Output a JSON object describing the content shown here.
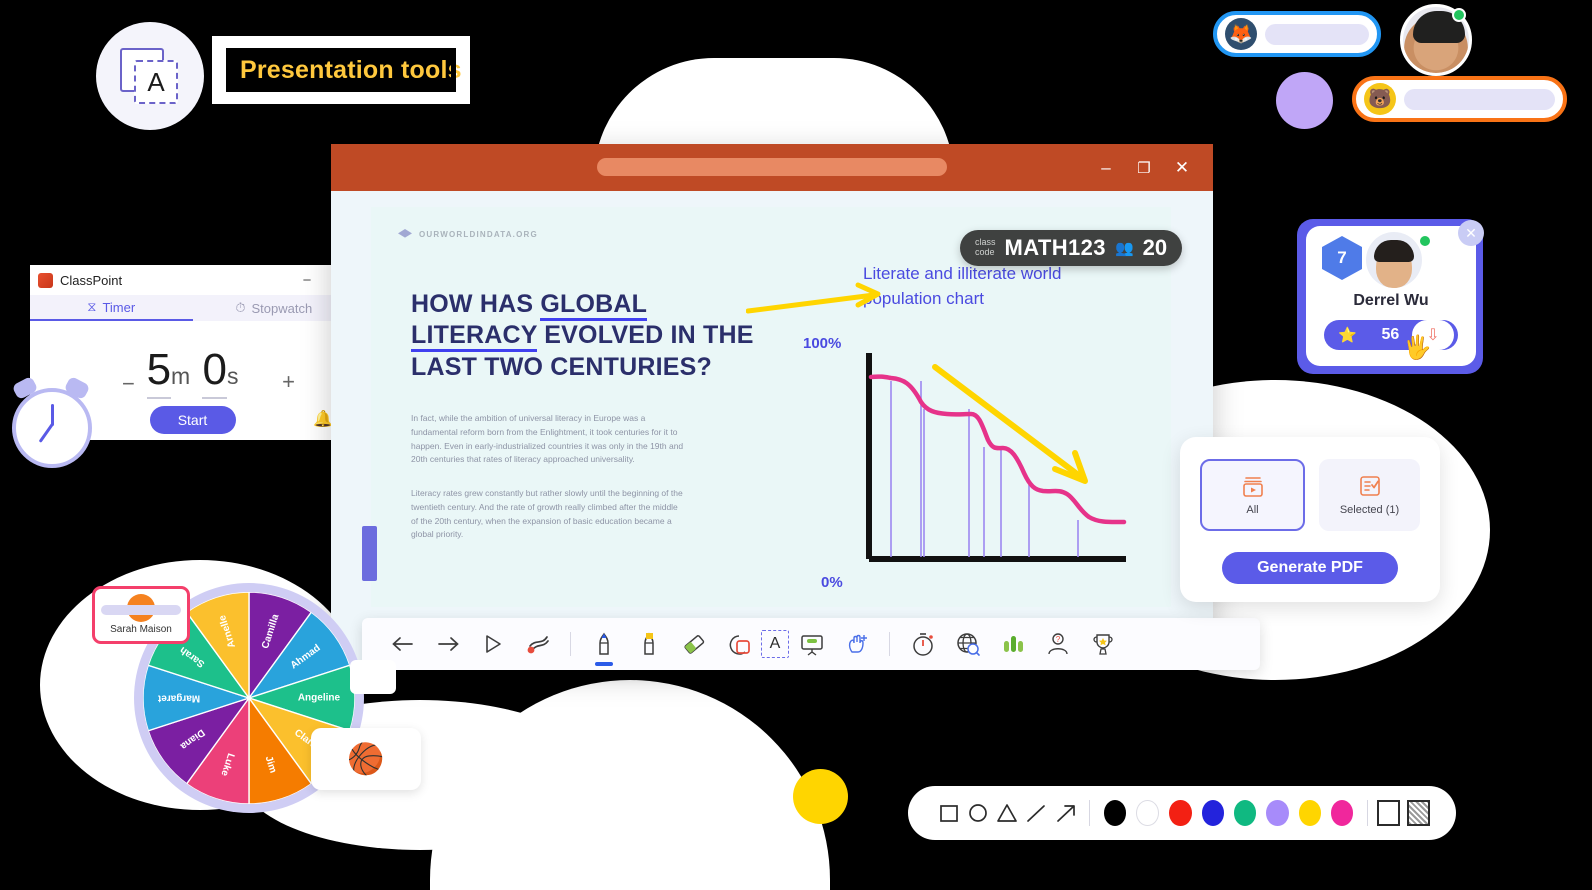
{
  "presentation_tools": {
    "label": "Presentation tools",
    "icon_letter": "A",
    "icon_name": "text-box-icon"
  },
  "top_pills": [
    {
      "avatar_icon": "fox-avatar",
      "emoji": "🦊",
      "color": "#2196F3"
    },
    {
      "avatar_icon": "bear-avatar",
      "emoji": "🐻",
      "color": "#F97316"
    }
  ],
  "classpoint_timer": {
    "title": "ClassPoint",
    "tabs": [
      {
        "label": "Timer",
        "icon": "hourglass-icon",
        "glyph": "⧖",
        "active": true
      },
      {
        "label": "Stopwatch",
        "icon": "stopwatch-icon",
        "glyph": "⏱",
        "active": false
      }
    ],
    "minutes": "5",
    "minutes_unit": "m",
    "seconds": "0",
    "seconds_unit": "s",
    "decrease_label": "−",
    "increase_label": "+",
    "start_label": "Start",
    "bell_icon": "bell-icon",
    "minimize_label": "−",
    "close_label": "✕"
  },
  "presentation_window": {
    "minimize_label": "–",
    "maximize_label": "❐",
    "close_label": "✕",
    "slide": {
      "source_label": "OURWORLDINDATA.ORG",
      "heading_parts": [
        {
          "text": "HOW HAS ",
          "underline": false
        },
        {
          "text": "GLOBAL LITERACY",
          "underline": true
        },
        {
          "text": " EVOLVED IN THE LAST TWO CENTURIES?",
          "underline": false
        }
      ],
      "heading_plain": "HOW HAS GLOBAL LITERACY EVOLVED IN THE LAST TWO CENTURIES?",
      "paragraph_1": "In fact, while the ambition of universal literacy in Europe was a fundamental reform born from the Enlightment, it took centuries for it to happen. Even in early-industrialized countries it was only in the 19th and 20th centuries that rates of literacy approached universality.",
      "paragraph_2": "Literacy rates grew constantly but rather slowly until the beginning of the twentieth century. And the rate of growth really climbed after the middle of the 20th century, when the expansion of basic education became a global priority."
    },
    "class_code": {
      "label_line1": "class",
      "label_line2": "code",
      "code": "MATH123",
      "participants_icon": "people-icon",
      "participants": "20"
    }
  },
  "chart_data": {
    "type": "line",
    "title": "Literate and illiterate world population chart",
    "xlabel": "",
    "ylabel": "",
    "ylim": [
      0,
      100
    ],
    "ytick_labels": [
      "100%",
      "0%"
    ],
    "line_color": "#E6338A",
    "gridline_color": "#9D87F0",
    "grid": true,
    "legend": "none",
    "annotation_arrow_color": "#FFD500",
    "x": [
      0,
      5,
      10,
      15,
      20,
      25,
      30,
      35,
      40,
      45,
      50,
      55,
      60,
      65,
      70,
      75,
      80,
      85,
      90,
      95,
      100
    ],
    "values": [
      93,
      93,
      92,
      90,
      84,
      79,
      78,
      78,
      77,
      68,
      66,
      66,
      60,
      50,
      44,
      43,
      40,
      33,
      25,
      23,
      23
    ],
    "vertical_marker_x": [
      8,
      20,
      45,
      53,
      60,
      74,
      93
    ]
  },
  "toolbar": {
    "items": [
      {
        "name": "previous-slide-button",
        "glyph": "←",
        "label": "Previous"
      },
      {
        "name": "next-slide-button",
        "glyph": "→",
        "label": "Next"
      },
      {
        "name": "pointer-tool-button",
        "glyph": "▷",
        "label": "Pointer"
      },
      {
        "name": "laser-pointer-button",
        "glyph": "⤳",
        "label": "Laser pointer"
      },
      {
        "name": "pen-tool-button",
        "glyph": "✒",
        "label": "Pen"
      },
      {
        "name": "highlighter-tool-button",
        "glyph": "✎",
        "label": "Highlighter"
      },
      {
        "name": "eraser-tool-button",
        "glyph": "▱",
        "label": "Eraser"
      },
      {
        "name": "shapes-tool-button",
        "glyph": "⬟",
        "label": "Shapes"
      },
      {
        "name": "text-box-button",
        "glyph": "A",
        "label": "Text box"
      },
      {
        "name": "whiteboard-button",
        "glyph": "⬜",
        "label": "Whiteboard"
      },
      {
        "name": "drag-tool-button",
        "glyph": "✋",
        "label": "Drag"
      },
      {
        "name": "timer-button",
        "glyph": "⏱",
        "label": "Timer"
      },
      {
        "name": "browser-button",
        "glyph": "ἱ0",
        "label": "Embedded browser"
      },
      {
        "name": "bar-chart-button",
        "glyph": "█",
        "label": "Polls"
      },
      {
        "name": "pick-name-button",
        "glyph": "☹",
        "label": "Pick name"
      },
      {
        "name": "leaderboard-button",
        "glyph": "Ἴ6",
        "label": "Leaderboard"
      }
    ]
  },
  "student_card": {
    "level": "7",
    "name": "Derrel Wu",
    "star_icon": "star-icon",
    "points": "56",
    "deduct_icon": "down-arrow-icon",
    "close_label": "✕",
    "online": true
  },
  "pdf_panel": {
    "options": [
      {
        "label": "All",
        "icon": "slides-stack-icon",
        "selected": true
      },
      {
        "label": "Selected (1)",
        "icon": "checklist-icon",
        "selected": false
      }
    ],
    "generate_label": "Generate PDF"
  },
  "name_picker": {
    "selected_name": "Sarah Maison",
    "segments": [
      {
        "name": "Camilla",
        "color": "#7B1FA2"
      },
      {
        "name": "Ahmad",
        "color": "#29A3DC"
      },
      {
        "name": "Angeline",
        "color": "#1DC08B"
      },
      {
        "name": "Clara",
        "color": "#FBC02D"
      },
      {
        "name": "Jim",
        "color": "#F57C00"
      },
      {
        "name": "Luke",
        "color": "#EC4079"
      },
      {
        "name": "Diana",
        "color": "#7B1FA2"
      },
      {
        "name": "Margaret",
        "color": "#29A3DC"
      },
      {
        "name": "Sarah",
        "color": "#1DC08B"
      },
      {
        "name": "Arnelle",
        "color": "#FBC02D"
      }
    ],
    "reward_emoji": "🏀"
  },
  "shape_toolbar": {
    "shapes": [
      {
        "name": "rectangle-shape-button",
        "glyph": "□"
      },
      {
        "name": "ellipse-shape-button",
        "glyph": "○"
      },
      {
        "name": "triangle-shape-button",
        "glyph": "△"
      },
      {
        "name": "line-shape-button",
        "glyph": "╱"
      },
      {
        "name": "arrow-shape-button",
        "glyph": "↗"
      }
    ],
    "colors": [
      "#000000",
      "#FFFFFF",
      "#F32013",
      "#2323DC",
      "#10B981",
      "#A78BFA",
      "#FFD500",
      "#F0279C"
    ],
    "fills": [
      {
        "name": "fill-none-button",
        "type": "outline"
      },
      {
        "name": "fill-hatch-button",
        "type": "hatch"
      }
    ]
  }
}
